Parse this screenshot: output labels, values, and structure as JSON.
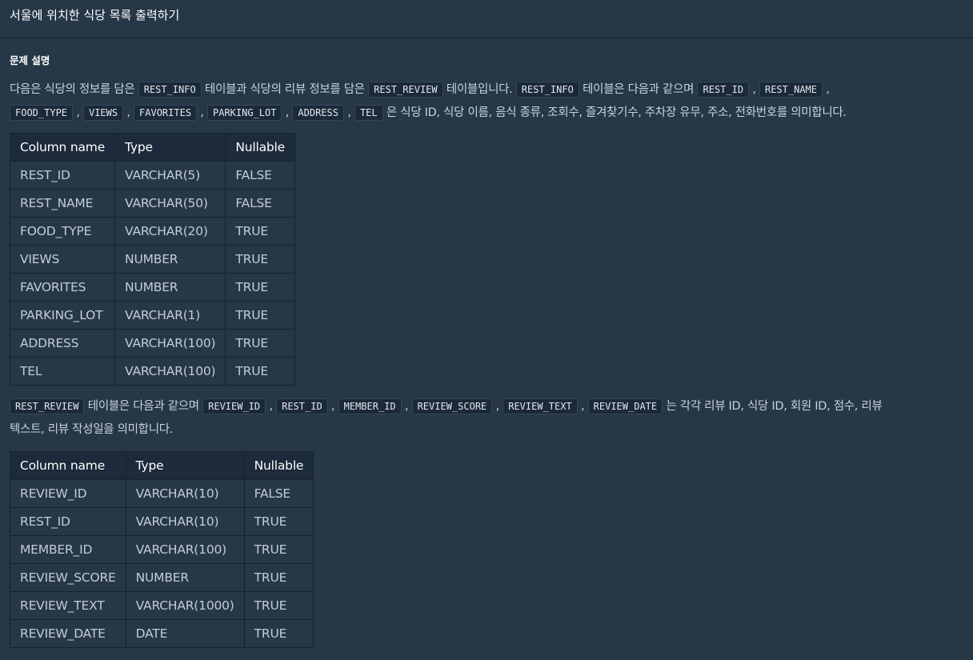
{
  "header": {
    "title": "서울에 위치한 식당 목록 출력하기"
  },
  "section": {
    "title": "문제 설명"
  },
  "para1": {
    "line1": [
      {
        "t": "text",
        "v": "다음은 식당의 정보를 담은 "
      },
      {
        "t": "code",
        "v": "REST_INFO"
      },
      {
        "t": "text",
        "v": " 테이블과 식당의 리뷰 정보를 담은 "
      },
      {
        "t": "code",
        "v": "REST_REVIEW"
      },
      {
        "t": "text",
        "v": " 테이블입니다. "
      },
      {
        "t": "code",
        "v": "REST_INFO"
      },
      {
        "t": "text",
        "v": " 테이블은 다음과 같으며 "
      },
      {
        "t": "code",
        "v": "REST_ID"
      },
      {
        "t": "text",
        "v": " , "
      },
      {
        "t": "code",
        "v": "REST_NAME"
      },
      {
        "t": "text",
        "v": " ,"
      }
    ],
    "line2": [
      {
        "t": "code",
        "v": "FOOD_TYPE"
      },
      {
        "t": "text",
        "v": " , "
      },
      {
        "t": "code",
        "v": "VIEWS"
      },
      {
        "t": "text",
        "v": " , "
      },
      {
        "t": "code",
        "v": "FAVORITES"
      },
      {
        "t": "text",
        "v": " , "
      },
      {
        "t": "code",
        "v": "PARKING_LOT"
      },
      {
        "t": "text",
        "v": " , "
      },
      {
        "t": "code",
        "v": "ADDRESS"
      },
      {
        "t": "text",
        "v": " , "
      },
      {
        "t": "code",
        "v": "TEL"
      },
      {
        "t": "text",
        "v": " 은 식당 ID, 식당 이름, 음식 종류, 조회수, 즐겨찾기수, 주차장 유무, 주소, 전화번호를 의미합니다."
      }
    ]
  },
  "table1": {
    "headers": [
      "Column name",
      "Type",
      "Nullable"
    ],
    "rows": [
      [
        "REST_ID",
        "VARCHAR(5)",
        "FALSE"
      ],
      [
        "REST_NAME",
        "VARCHAR(50)",
        "FALSE"
      ],
      [
        "FOOD_TYPE",
        "VARCHAR(20)",
        "TRUE"
      ],
      [
        "VIEWS",
        "NUMBER",
        "TRUE"
      ],
      [
        "FAVORITES",
        "NUMBER",
        "TRUE"
      ],
      [
        "PARKING_LOT",
        "VARCHAR(1)",
        "TRUE"
      ],
      [
        "ADDRESS",
        "VARCHAR(100)",
        "TRUE"
      ],
      [
        "TEL",
        "VARCHAR(100)",
        "TRUE"
      ]
    ]
  },
  "para2": {
    "line1": [
      {
        "t": "code",
        "v": "REST_REVIEW"
      },
      {
        "t": "text",
        "v": " 테이블은 다음과 같으며 "
      },
      {
        "t": "code",
        "v": "REVIEW_ID"
      },
      {
        "t": "text",
        "v": " , "
      },
      {
        "t": "code",
        "v": "REST_ID"
      },
      {
        "t": "text",
        "v": " , "
      },
      {
        "t": "code",
        "v": "MEMBER_ID"
      },
      {
        "t": "text",
        "v": " , "
      },
      {
        "t": "code",
        "v": "REVIEW_SCORE"
      },
      {
        "t": "text",
        "v": " , "
      },
      {
        "t": "code",
        "v": "REVIEW_TEXT"
      },
      {
        "t": "text",
        "v": " , "
      },
      {
        "t": "code",
        "v": "REVIEW_DATE"
      },
      {
        "t": "text",
        "v": " 는 각각 리뷰 ID, 식당 ID, 회원 ID, 점수, 리뷰"
      }
    ],
    "line2": [
      {
        "t": "text",
        "v": "텍스트, 리뷰 작성일을 의미합니다."
      }
    ]
  },
  "table2": {
    "headers": [
      "Column name",
      "Type",
      "Nullable"
    ],
    "rows": [
      [
        "REVIEW_ID",
        "VARCHAR(10)",
        "FALSE"
      ],
      [
        "REST_ID",
        "VARCHAR(10)",
        "TRUE"
      ],
      [
        "MEMBER_ID",
        "VARCHAR(100)",
        "TRUE"
      ],
      [
        "REVIEW_SCORE",
        "NUMBER",
        "TRUE"
      ],
      [
        "REVIEW_TEXT",
        "VARCHAR(1000)",
        "TRUE"
      ],
      [
        "REVIEW_DATE",
        "DATE",
        "TRUE"
      ]
    ]
  }
}
